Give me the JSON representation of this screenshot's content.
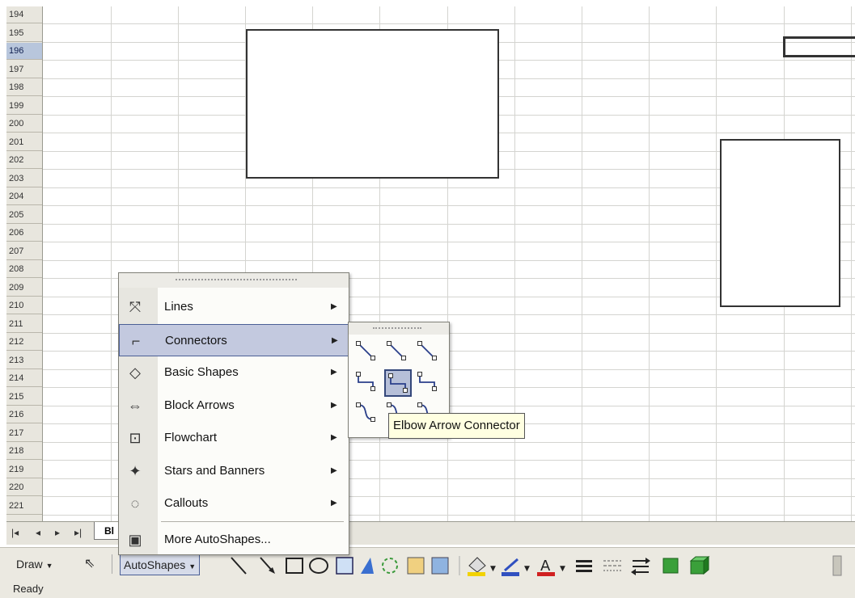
{
  "row_headers": [
    "194",
    "195",
    "196",
    "197",
    "198",
    "199",
    "200",
    "201",
    "202",
    "203",
    "204",
    "205",
    "206",
    "207",
    "208",
    "209",
    "210",
    "211",
    "212",
    "213",
    "214",
    "215",
    "216",
    "217",
    "218",
    "219",
    "220",
    "221"
  ],
  "active_row": "196",
  "sheet_nav": {
    "first": "|◂",
    "prev": "◂",
    "next": "▸",
    "last": "▸|",
    "tab_label": "Bl"
  },
  "autoshapes_menu": {
    "items": [
      {
        "label": "Lines",
        "icon": "lines-icon",
        "has_submenu": true
      },
      {
        "label": "Connectors",
        "icon": "connectors-icon",
        "has_submenu": true,
        "highlighted": true
      },
      {
        "label": "Basic Shapes",
        "icon": "basic-shapes-icon",
        "has_submenu": true
      },
      {
        "label": "Block Arrows",
        "icon": "block-arrows-icon",
        "has_submenu": true
      },
      {
        "label": "Flowchart",
        "icon": "flowchart-icon",
        "has_submenu": true
      },
      {
        "label": "Stars and Banners",
        "icon": "stars-banners-icon",
        "has_submenu": true
      },
      {
        "label": "Callouts",
        "icon": "callouts-icon",
        "has_submenu": true
      },
      {
        "label": "More AutoShapes...",
        "icon": "more-autoshapes-icon",
        "has_submenu": false
      }
    ]
  },
  "connectors_submenu": {
    "items": [
      "straight-connector",
      "straight-arrow-connector",
      "straight-double-arrow-connector",
      "elbow-connector",
      "elbow-arrow-connector",
      "elbow-double-arrow-connector",
      "curved-connector",
      "curved-arrow-connector",
      "curved-double-arrow-connector"
    ],
    "selected": "elbow-arrow-connector",
    "tooltip": "Elbow Arrow Connector"
  },
  "drawing_toolbar": {
    "draw_label": "Draw",
    "autoshapes_label": "AutoShapes",
    "tools": [
      "line-icon",
      "arrow-icon",
      "rectangle-icon",
      "oval-icon",
      "text-box-icon",
      "wordart-icon",
      "diagram-icon",
      "clip-art-icon",
      "picture-icon",
      "fill-color-icon",
      "line-color-icon",
      "font-color-icon",
      "line-style-icon",
      "dash-style-icon",
      "arrow-style-icon",
      "shadow-style-icon",
      "3d-style-icon"
    ]
  },
  "status_text": "Ready",
  "colors": {
    "menu_highlight": "#c3c9df",
    "tooltip_bg": "#ffffe1",
    "font_color_red": "#d02020",
    "fill_yellow": "#f2d200"
  }
}
